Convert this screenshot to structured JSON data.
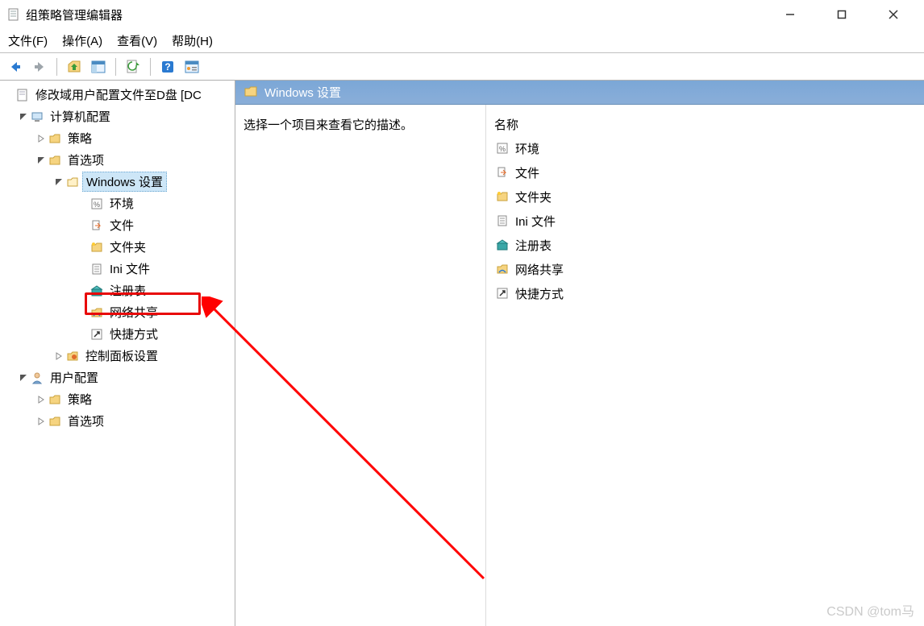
{
  "window": {
    "title": "组策略管理编辑器"
  },
  "menubar": {
    "file": "文件(F)",
    "action": "操作(A)",
    "view": "查看(V)",
    "help": "帮助(H)"
  },
  "tree": {
    "root_label": "修改域用户配置文件至D盘 [DC",
    "computer_config": "计算机配置",
    "policy": "策略",
    "preferences": "首选项",
    "windows_settings": "Windows 设置",
    "env": "环境",
    "files": "文件",
    "folders": "文件夹",
    "ini": "Ini 文件",
    "registry": "注册表",
    "netshare": "网络共享",
    "shortcut": "快捷方式",
    "cp_settings": "控制面板设置",
    "user_config": "用户配置",
    "user_policy": "策略",
    "user_pref": "首选项"
  },
  "right": {
    "header": "Windows 设置",
    "description": "选择一个项目来查看它的描述。",
    "col_name": "名称",
    "items": {
      "env": "环境",
      "files": "文件",
      "folders": "文件夹",
      "ini": "Ini 文件",
      "registry": "注册表",
      "netshare": "网络共享",
      "shortcut": "快捷方式"
    }
  },
  "watermark": "CSDN @tom马"
}
